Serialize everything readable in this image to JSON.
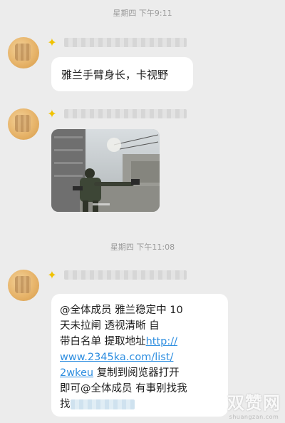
{
  "messages": [
    {
      "timestamp": "星期四 下午9:11",
      "type": "text",
      "text": "雅兰手臂身长，卡视野"
    },
    {
      "type": "image",
      "image_alt": "game screenshot"
    },
    {
      "timestamp": "星期四 下午11:08",
      "type": "text",
      "lines": [
        "@全体成员  雅兰稳定中  10",
        "天未拉闸   透视清晰   自",
        "带白名单   提取地址",
        "复制到阅览器打开",
        "即可@全体成员 有事别找我",
        "找"
      ],
      "link_parts": [
        "http://",
        "www.2345ka.com/list/",
        "2wkeu"
      ]
    }
  ],
  "watermark": {
    "brand": "双赞网",
    "url": "shuangzan.com"
  },
  "colors": {
    "background": "#ececec",
    "bubble": "#ffffff",
    "link": "#2e8ee0",
    "badge": "#f0c200"
  }
}
